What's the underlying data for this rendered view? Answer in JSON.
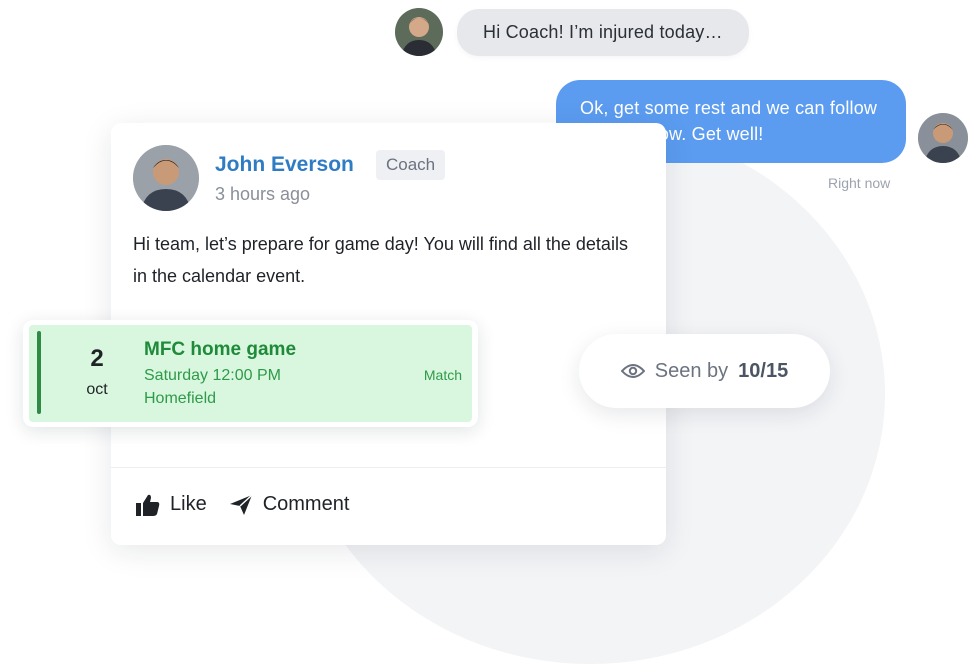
{
  "chat": {
    "incoming": {
      "text": "Hi Coach! I’m injured today…"
    },
    "outgoing": {
      "text": "Ok, get some rest and we can follow up tomorrow. Get well!",
      "time": "Right now"
    }
  },
  "post": {
    "author": "John Everson",
    "role": "Coach",
    "time": "3 hours ago",
    "body": "Hi team, let’s prepare for game day! You will find all the details in the calendar event.",
    "actions": {
      "like": "Like",
      "comment": "Comment"
    }
  },
  "event": {
    "day": "2",
    "month": "oct",
    "title": "MFC home game",
    "when": "Saturday 12:00 PM",
    "where": "Homefield",
    "type": "Match",
    "accent_color": "#2f8a45",
    "background_color": "#d9f7de"
  },
  "seen": {
    "label": "Seen by",
    "count": "10/15"
  },
  "icons": {
    "like": "thumbs-up-icon",
    "comment": "send-icon",
    "seen": "eye-icon"
  },
  "colors": {
    "accent_blue": "#5b9cf0",
    "author_blue": "#2f7cc4",
    "incoming_bubble": "#e6e8ec"
  }
}
